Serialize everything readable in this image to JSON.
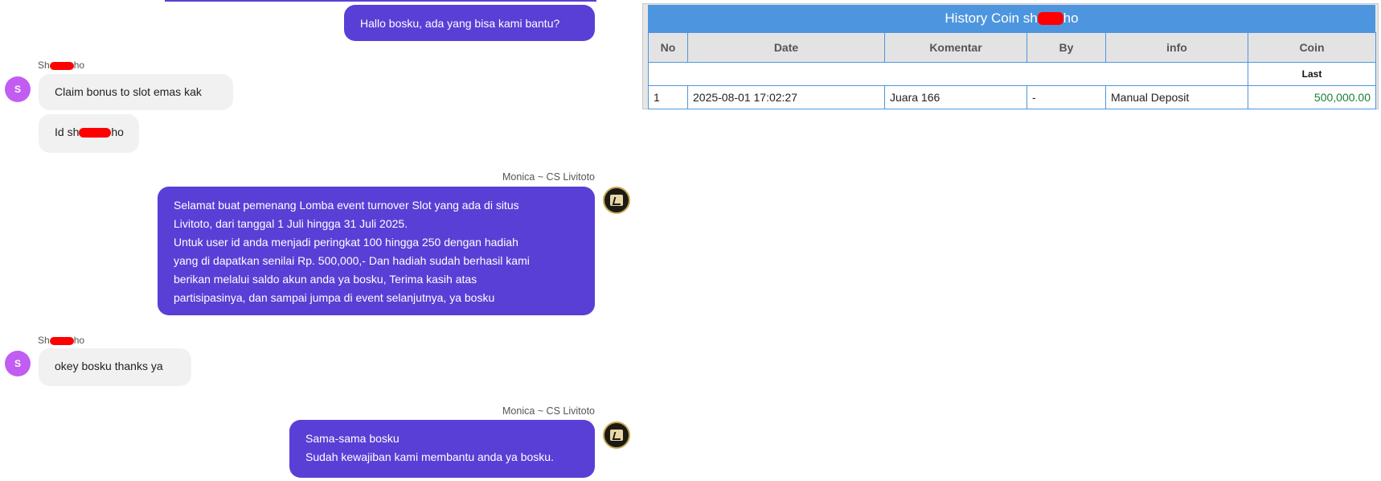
{
  "chat": {
    "messages": [
      {
        "from": "agent",
        "text": "Hallo bosku, ada yang bisa kami bantu?"
      },
      {
        "from": "user",
        "sender_prefix": "Sh",
        "sender_suffix": "ho",
        "avatar": "S",
        "lines": [
          "Claim bonus to slot emas kak"
        ],
        "line2_prefix": "Id sh",
        "line2_suffix": "ho"
      },
      {
        "from": "agent",
        "sender": "Monica ~ CS Livitoto",
        "lines": [
          "Selamat buat pemenang Lomba event turnover Slot yang ada di situs",
          "Livitoto, dari tanggal 1 Juli hingga 31 Juli 2025.",
          "Untuk user id anda menjadi peringkat 100 hingga 250 dengan hadiah",
          "yang di dapatkan senilai Rp. 500,000,- Dan hadiah sudah berhasil kami",
          "berikan melalui saldo akun anda ya bosku, Terima kasih atas",
          "partisipasinya, dan sampai jumpa di event selanjutnya, ya bosku"
        ]
      },
      {
        "from": "user",
        "sender_prefix": "Sh",
        "sender_suffix": "ho",
        "avatar": "S",
        "lines": [
          "okey bosku thanks ya"
        ]
      },
      {
        "from": "agent",
        "sender": "Monica ~ CS Livitoto",
        "lines": [
          "Sama-sama bosku",
          "Sudah kewajiban kami membantu anda ya bosku."
        ]
      }
    ]
  },
  "history": {
    "title_prefix": "History Coin sh",
    "title_suffix": "ho",
    "columns": [
      "No",
      "Date",
      "Komentar",
      "By",
      "info",
      "Coin"
    ],
    "sub_header": "Last",
    "rows": [
      {
        "no": "1",
        "date": "2025-08-01 17:02:27",
        "komentar": "Juara 166",
        "by": "-",
        "info": "Manual Deposit",
        "coin": "500,000.00"
      }
    ]
  },
  "colors": {
    "agent_bubble": "#5a3fd6",
    "user_bubble": "#f1f1f1",
    "user_avatar": "#c25df2",
    "table_header": "#4d96df",
    "amount": "#1a7f37",
    "redaction": "#ff0000"
  }
}
